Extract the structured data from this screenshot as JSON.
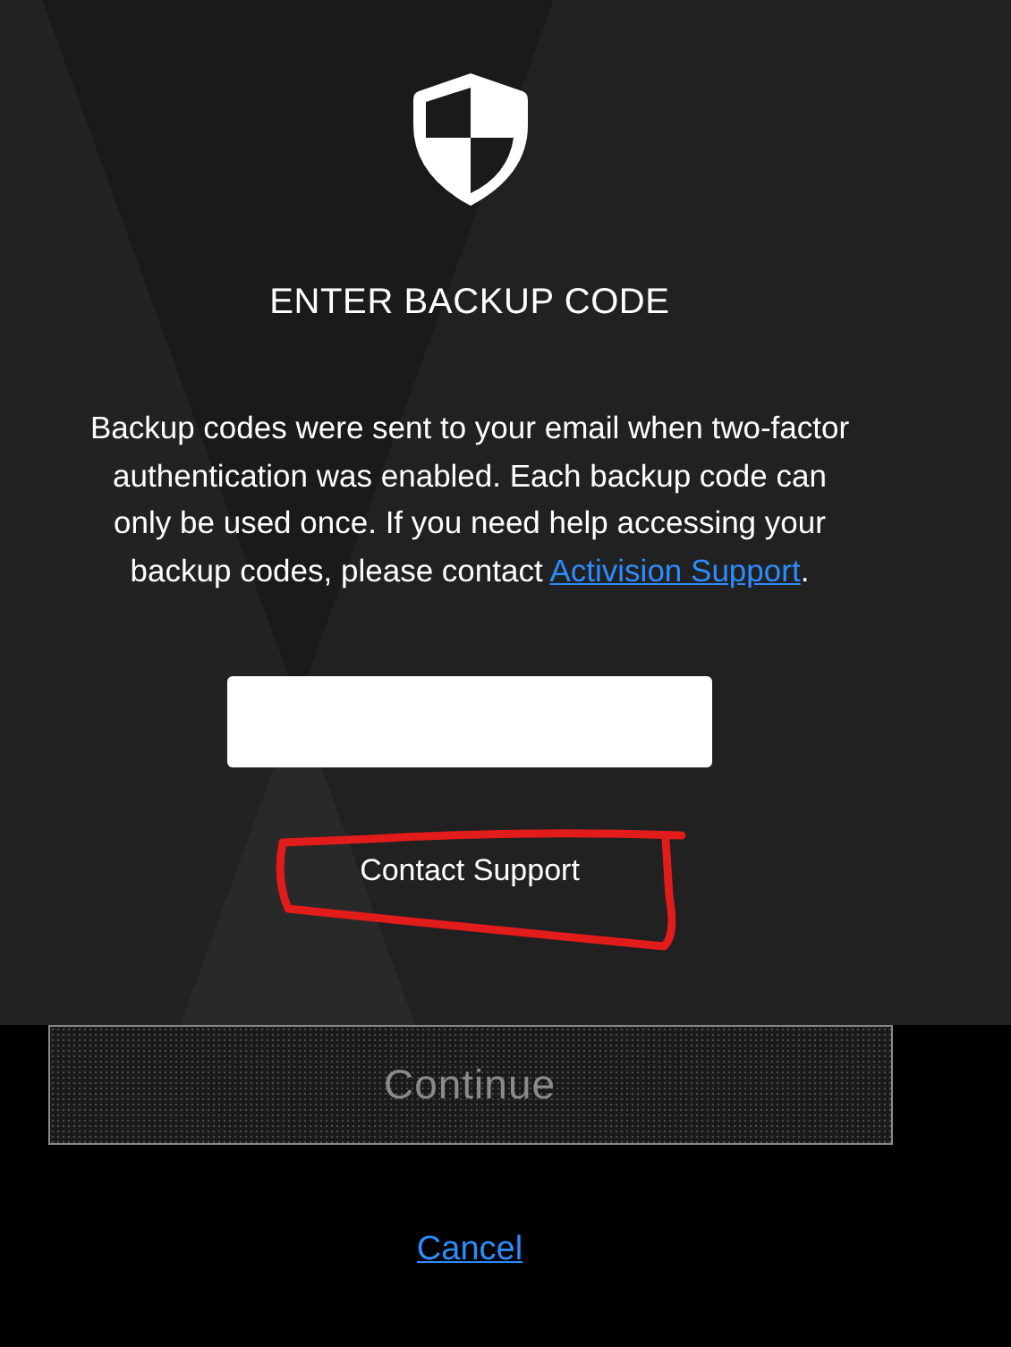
{
  "heading": "ENTER BACKUP CODE",
  "description": {
    "text": "Backup codes were sent to your email when two-factor authentication was enabled. Each backup code can only be used once. If you need help accessing your backup codes, please contact ",
    "link": "Activision Support",
    "after": "."
  },
  "contact_button": "Contact Support",
  "continue_button": {
    "label": "Continue",
    "disabled": true
  },
  "cancel_link": "Cancel"
}
